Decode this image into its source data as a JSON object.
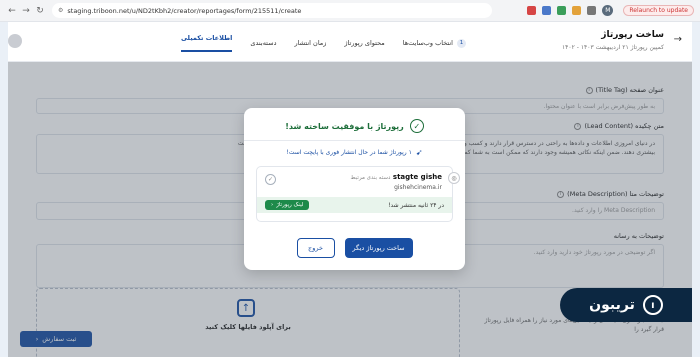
{
  "browser": {
    "url": "staging.triboon.net/u/ND2tKbh2/creator/reportages/form/215511/create",
    "profile_initial": "M",
    "relaunch_label": "Relaunch to update"
  },
  "header": {
    "title": "ساخت رپورتاژ",
    "subtitle": "کمپین رپورتاژ ۲۱ اردیبهشت ۱۴۰۳ - ۱۴۰۲",
    "tabs": [
      {
        "label": "انتخاب وب‌سایت‌ها",
        "badge": "1"
      },
      {
        "label": "محتوای رپورتاژ"
      },
      {
        "label": "زمان انتشار"
      },
      {
        "label": "دسته‌بندی"
      },
      {
        "label": "اطلاعات تکمیلی"
      }
    ]
  },
  "form": {
    "title_tag_label": "عنوان صفحه (Title Tag)",
    "title_tag_placeholder": "به طور پیش‌فرض برابر است با عنوان محتوا.",
    "lead_label": "متن چکیده (Lead Content)",
    "lead_text_1": "در دنیای امروزی اطلاعات و داده‌ها به راحتی در دسترس قرار دارند و کسب و کارها را با ... تا ممکن است برای خرید هر محصولی ندانند که باید به چه ویژگی‌هایی اهمیت",
    "lead_text_2": "بیشتری دهند. ضمن اینکه نکاتی همیشه وجود دارند که ممکن است به شما کمک کند.",
    "meta_label": "توضیحات متا (Meta Description)",
    "meta_placeholder": "Meta Description را وارد کنید.",
    "media_label": "توضیحات به رسانه",
    "media_placeholder": "اگر توضیحی در مورد رپورتاژ خود دارید وارد کنید.",
    "upload_label": "برای آپلود فایلها کلیک کنید",
    "side_note": "جداگانه بارگذاری کنید. می‌توانید فایل‌های مورد نیاز را همراه فایل رپورتاژ قرار گیرد را",
    "submit_label": "ثبت سفارش"
  },
  "modal": {
    "title": "رپورتاژ با موفقیت ساخته شد!",
    "info": "۱ رپورتاژ شما در حال انتشار فوری با پایچت است!",
    "site_name": "stagte gishe",
    "site_category": "دسته بندی مرتبط",
    "site_domain": "gishehcinema.ir",
    "publish_note": "در ۲۴ ثانیه منتشر شد!",
    "link_label": "لینک رپورتاژ",
    "primary_label": "ساخت رپورتاژ دیگر",
    "secondary_label": "خروج"
  },
  "logo": {
    "text": "تریبون"
  },
  "colors": {
    "primary": "#1a4fa3",
    "success": "#1d6e3a",
    "logo_bg": "#0c2741"
  }
}
